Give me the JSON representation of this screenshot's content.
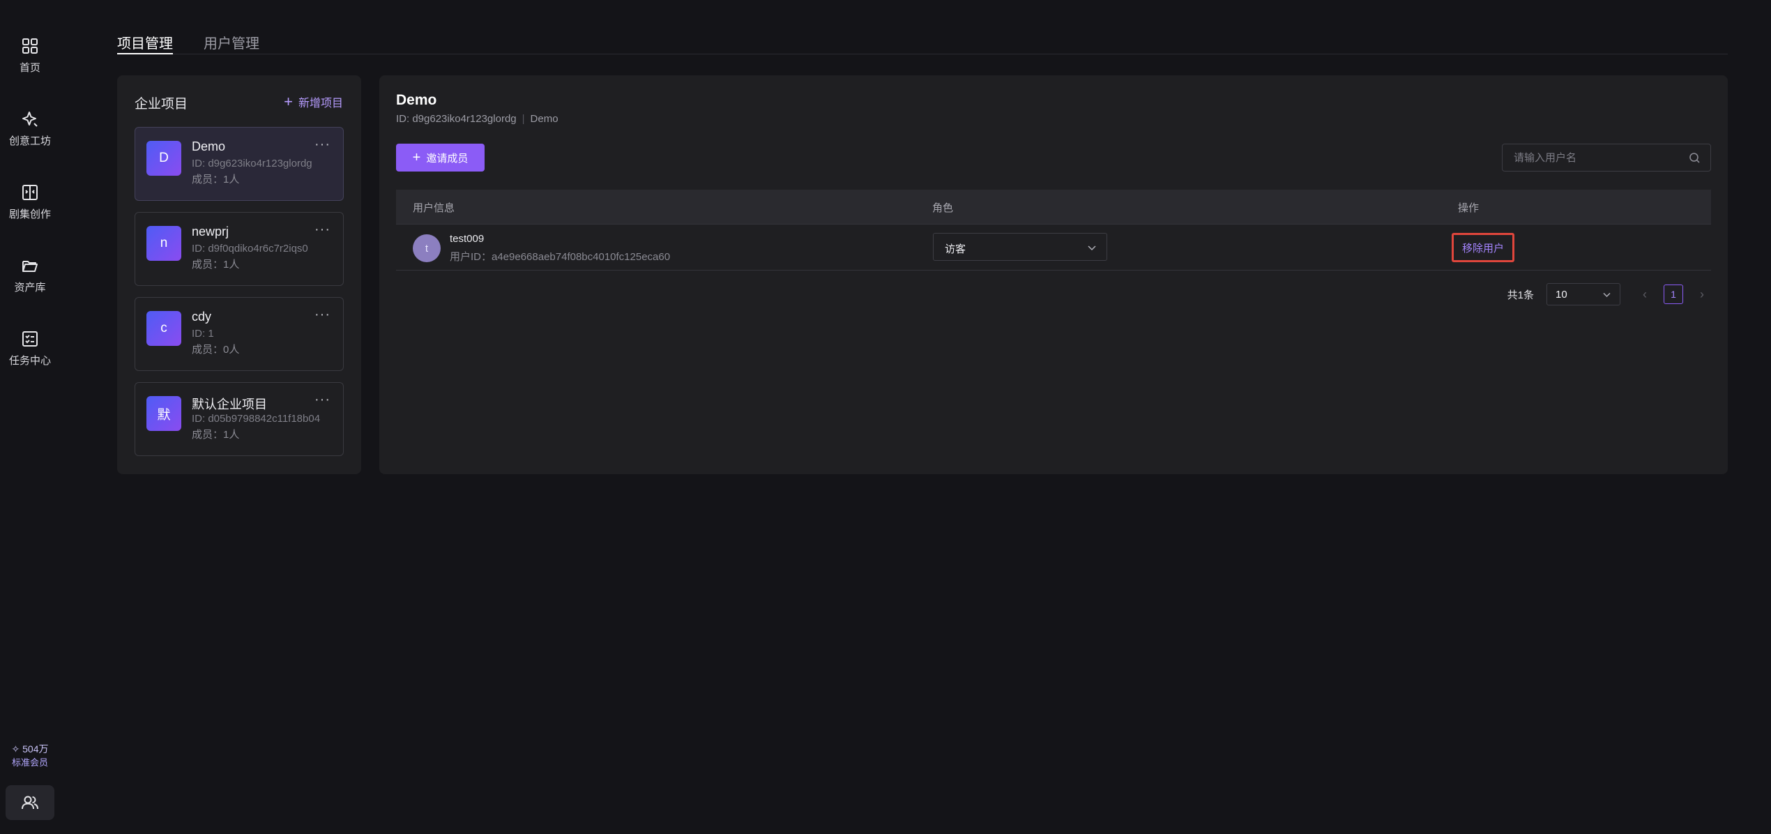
{
  "rail": {
    "items": [
      {
        "label": "首页",
        "icon": "grid-icon"
      },
      {
        "label": "创意工坊",
        "icon": "sparkle-icon"
      },
      {
        "label": "剧集创作",
        "icon": "book-icon"
      },
      {
        "label": "资产库",
        "icon": "folder-icon"
      },
      {
        "label": "任务中心",
        "icon": "checklist-icon"
      }
    ],
    "credits": "✧ 504万",
    "membership": "标准会员"
  },
  "tabs": [
    {
      "label": "项目管理",
      "active": true
    },
    {
      "label": "用户管理",
      "active": false
    }
  ],
  "projects_panel": {
    "title": "企业项目",
    "add_label": "新增项目",
    "items": [
      {
        "initial": "D",
        "name": "Demo",
        "id": "ID: d9g623iko4r123glordg",
        "members": "成员：1人",
        "selected": true
      },
      {
        "initial": "n",
        "name": "newprj",
        "id": "ID: d9f0qdiko4r6c7r2iqs0",
        "members": "成员：1人",
        "selected": false
      },
      {
        "initial": "c",
        "name": "cdy",
        "id": "ID: 1",
        "members": "成员：0人",
        "selected": false
      },
      {
        "initial": "默",
        "name": "默认企业项目",
        "id": "ID: d05b9798842c11f18b04",
        "members": "成员：1人",
        "selected": false
      }
    ],
    "more_glyph": "···"
  },
  "detail": {
    "title": "Demo",
    "id": "ID: d9g623iko4r123glordg",
    "subtitle": "Demo",
    "invite_label": "邀请成员",
    "search_placeholder": "请输入用户名",
    "columns": {
      "user": "用户信息",
      "role": "角色",
      "action": "操作"
    },
    "rows": [
      {
        "initial": "t",
        "name": "test009",
        "user_id": "用户ID：a4e9e668aeb74f08bc4010fc125eca60",
        "role": "访客",
        "action_label": "移除用户"
      }
    ],
    "pagination": {
      "total": "共1条",
      "page_size": "10",
      "current_page": "1",
      "prev": "‹",
      "next": "›"
    }
  },
  "colors": {
    "accent": "#8b5cf6",
    "highlight_border": "#e0463c"
  }
}
